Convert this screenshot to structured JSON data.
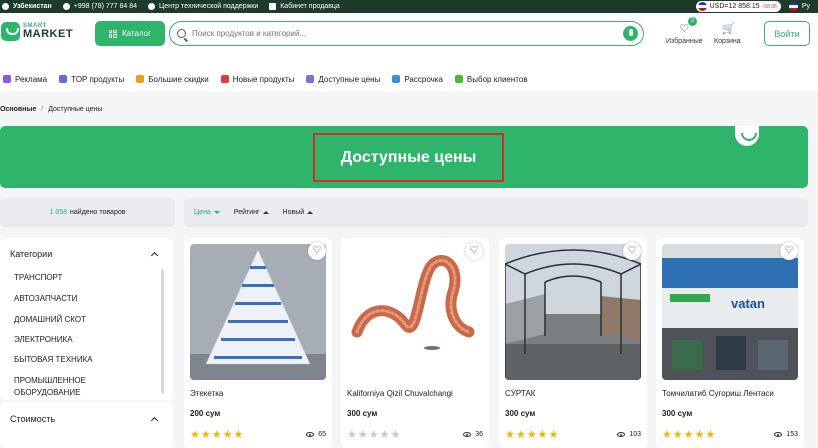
{
  "topbar": {
    "region": "Узбекистан",
    "phone": "+998 (78) 777 84 84",
    "support": "Центр технической поддержки",
    "seller": "Кабинет продавца",
    "currency": "USD=12 858.15",
    "currency_delta": "-58.95",
    "language": "Ру"
  },
  "header": {
    "logo_small": "SMART",
    "logo_big": "MARKET",
    "catalog_label": "Каталог",
    "search_placeholder": "Поиск продуктов и категорий...",
    "favorites_label": "Избранные",
    "favorites_count": "2",
    "cart_label": "Корзина",
    "login_label": "Войти"
  },
  "nav": [
    {
      "label": "Реклама",
      "icon": "megaphone-icon",
      "color": "#8e5ad8"
    },
    {
      "label": "TOP продукты",
      "icon": "top-icon",
      "color": "#5b6fd6"
    },
    {
      "label": "Большие скидки",
      "icon": "discount-icon",
      "color": "#e0a31a"
    },
    {
      "label": "Новые продукты",
      "icon": "new-icon",
      "color": "#e03b3b"
    },
    {
      "label": "Доступные цены",
      "icon": "price-icon",
      "color": "#7c6fe0"
    },
    {
      "label": "Рассрочка",
      "icon": "installment-icon",
      "color": "#3a8fd8"
    },
    {
      "label": "Выбор клиентов",
      "icon": "thumb-icon",
      "color": "#4cbb3c"
    }
  ],
  "breadcrumb": {
    "home": "Основные",
    "current": "Доступные цены"
  },
  "banner": {
    "title": "Доступные цены"
  },
  "results": {
    "count": "1 058",
    "suffix": "найдено товаров"
  },
  "sort": {
    "price": "Цена",
    "rating": "Рейтинг",
    "new": "Новый"
  },
  "sidebar": {
    "categories_title": "Категории",
    "categories": [
      "ТРАНСПОРТ",
      "АВТОЗАПЧАСТИ",
      "ДОМАШНИЙ СКОТ",
      "ЭЛЕКТРОНИКА",
      "БЫТОВАЯ ТЕХНИКА",
      "ПРОМЫШЛЕННОЕ",
      "ОБОРУДОВАНИЕ"
    ],
    "price_title": "Стоимость"
  },
  "products": [
    {
      "name": "Этекетка",
      "price": "200 сум",
      "rating": 5,
      "views": "65"
    },
    {
      "name": "Kaliforniya Qizil Chuvalchangi",
      "price": "300 сум",
      "rating": 0,
      "views": "36"
    },
    {
      "name": "CЎРТАК",
      "price": "300 сум",
      "rating": 5,
      "views": "103"
    },
    {
      "name": "Томчилатиб Сугориш Лентаси",
      "price": "300 сум",
      "rating": 5,
      "views": "153"
    }
  ],
  "product_images": [
    {
      "alt": "",
      "logo_text": ""
    },
    {
      "alt": "",
      "logo_text": ""
    },
    {
      "alt": "",
      "logo_text": ""
    },
    {
      "alt": "",
      "logo_text": "vatan"
    }
  ]
}
